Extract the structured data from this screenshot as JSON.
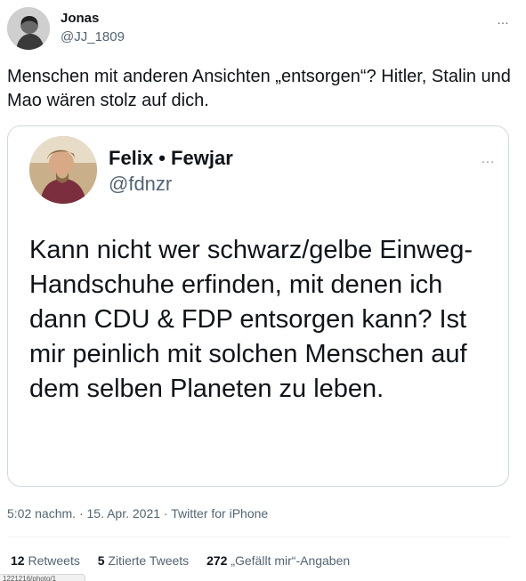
{
  "tweet": {
    "author_name": "Jonas",
    "author_handle": "@JJ_1809",
    "more_icon": "…",
    "text": "Menschen mit anderen Ansichten „entsorgen“? Hitler, Stalin und Mao wären stolz auf dich."
  },
  "quote": {
    "author_name": "Felix • Fewjar",
    "author_handle": "@fdnzr",
    "more_icon": "…",
    "text": "Kann nicht wer schwarz/gelbe Einweg-Handschuhe erfinden, mit denen ich dann CDU & FDP entsorgen kann? Ist mir peinlich mit solchen Menschen auf dem selben Planeten zu leben."
  },
  "meta": {
    "time": "5:02 nachm.",
    "separator": " · ",
    "date": "15. Apr. 2021",
    "source": "Twitter for iPhone"
  },
  "stats": {
    "retweets_count": "12",
    "retweets_label": "Retweets",
    "quotes_count": "5",
    "quotes_label": "Zitierte Tweets",
    "likes_count": "272",
    "likes_label": "„Gefällt mir“-Angaben"
  },
  "browser": {
    "status_url": "1221216/photo/1"
  }
}
